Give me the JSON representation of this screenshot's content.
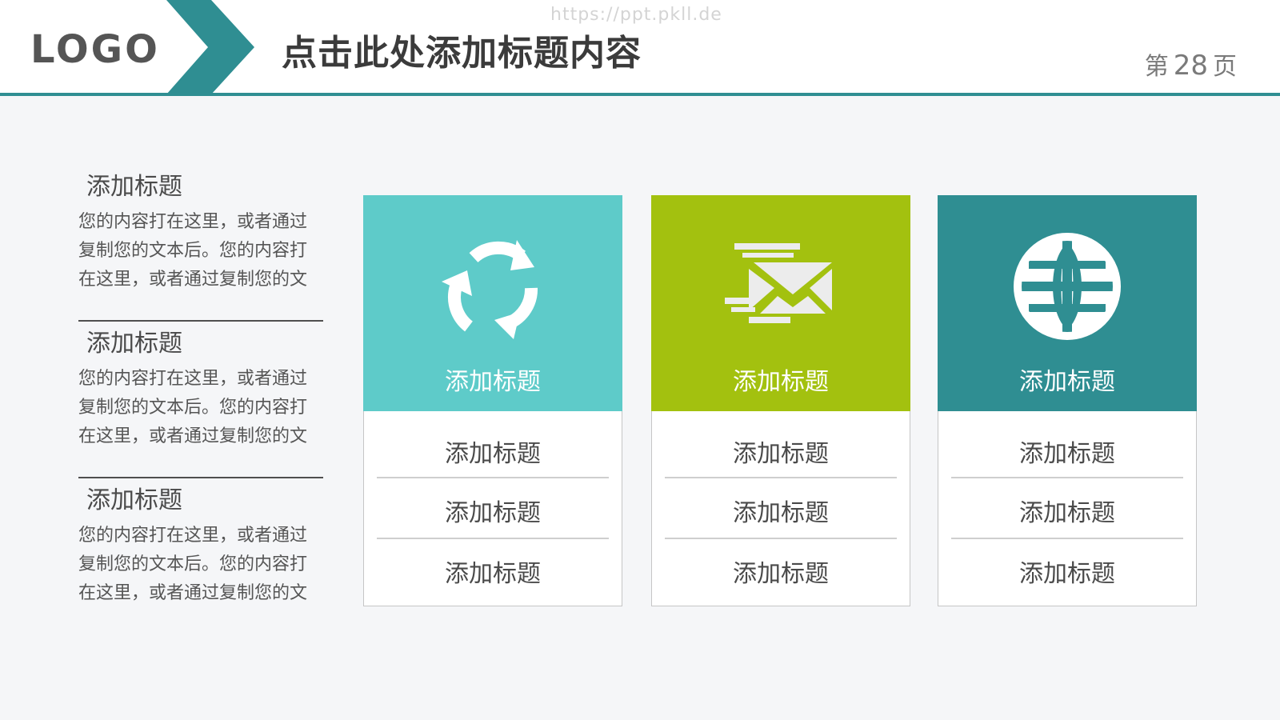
{
  "watermark": "https://ppt.pkll.de",
  "header": {
    "logo": "LOGO",
    "title": "点击此处添加标题内容",
    "page_prefix": "第",
    "page_number": "28",
    "page_suffix": "页"
  },
  "colors": {
    "accent": "#2f8e92",
    "card1": "#5ecbc9",
    "card2": "#a3c10f",
    "card3": "#2f8e92"
  },
  "left_items": [
    {
      "title": "添加标题",
      "body": "您的内容打在这里，或者通过复制您的文本后。您的内容打在这里，或者通过复制您的文"
    },
    {
      "title": "添加标题",
      "body": "您的内容打在这里，或者通过复制您的文本后。您的内容打在这里，或者通过复制您的文"
    },
    {
      "title": "添加标题",
      "body": "您的内容打在这里，或者通过复制您的文本后。您的内容打在这里，或者通过复制您的文"
    }
  ],
  "cards": [
    {
      "icon": "recycle-arrows-icon",
      "label": "添加标题",
      "rows": [
        "添加标题",
        "添加标题",
        "添加标题"
      ]
    },
    {
      "icon": "fast-mail-envelope-icon",
      "label": "添加标题",
      "rows": [
        "添加标题",
        "添加标题",
        "添加标题"
      ]
    },
    {
      "icon": "globe-icon",
      "label": "添加标题",
      "rows": [
        "添加标题",
        "添加标题",
        "添加标题"
      ]
    }
  ]
}
